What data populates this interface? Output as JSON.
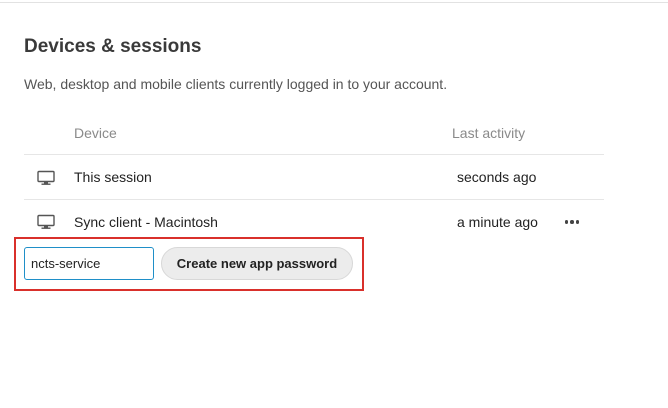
{
  "section": {
    "title": "Devices & sessions",
    "description": "Web, desktop and mobile clients currently logged in to your account."
  },
  "table": {
    "headers": {
      "device": "Device",
      "last_activity": "Last activity"
    },
    "rows": [
      {
        "icon": "desktop-icon",
        "device": "This session",
        "last_activity": "seconds ago"
      },
      {
        "icon": "desktop-icon",
        "device": "Sync client - Macintosh",
        "last_activity": "a minute ago",
        "has_menu": true
      }
    ]
  },
  "app_password": {
    "input_value": "ncts-service",
    "button_label": "Create new app password"
  },
  "colors": {
    "highlight": "#d9302b",
    "input_border": "#1f8fc8",
    "button_bg": "#ececec"
  }
}
